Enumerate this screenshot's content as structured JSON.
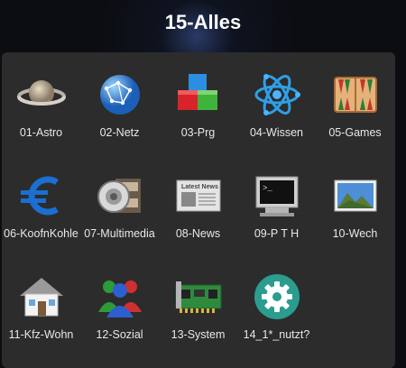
{
  "folder": {
    "title": "15-Alles"
  },
  "apps": [
    {
      "label": "01-Astro",
      "icon": "saturn-icon"
    },
    {
      "label": "02-Netz",
      "icon": "globe-network-icon"
    },
    {
      "label": "03-Prg",
      "icon": "cubes-icon"
    },
    {
      "label": "04-Wissen",
      "icon": "atom-icon"
    },
    {
      "label": "05-Games",
      "icon": "backgammon-icon"
    },
    {
      "label": "06-KoofnKohle",
      "icon": "euro-icon"
    },
    {
      "label": "07-Multimedia",
      "icon": "speaker-film-icon"
    },
    {
      "label": "08-News",
      "icon": "newspaper-icon"
    },
    {
      "label": "09-P T H",
      "icon": "terminal-icon"
    },
    {
      "label": "10-Wech",
      "icon": "landscape-photo-icon"
    },
    {
      "label": "11-Kfz-Wohn",
      "icon": "house-icon"
    },
    {
      "label": "12-Sozial",
      "icon": "people-icon"
    },
    {
      "label": "13-System",
      "icon": "circuit-board-icon"
    },
    {
      "label": "14_1*_nutzt?",
      "icon": "settings-gear-icon"
    }
  ],
  "newspaper_text": "Latest News"
}
